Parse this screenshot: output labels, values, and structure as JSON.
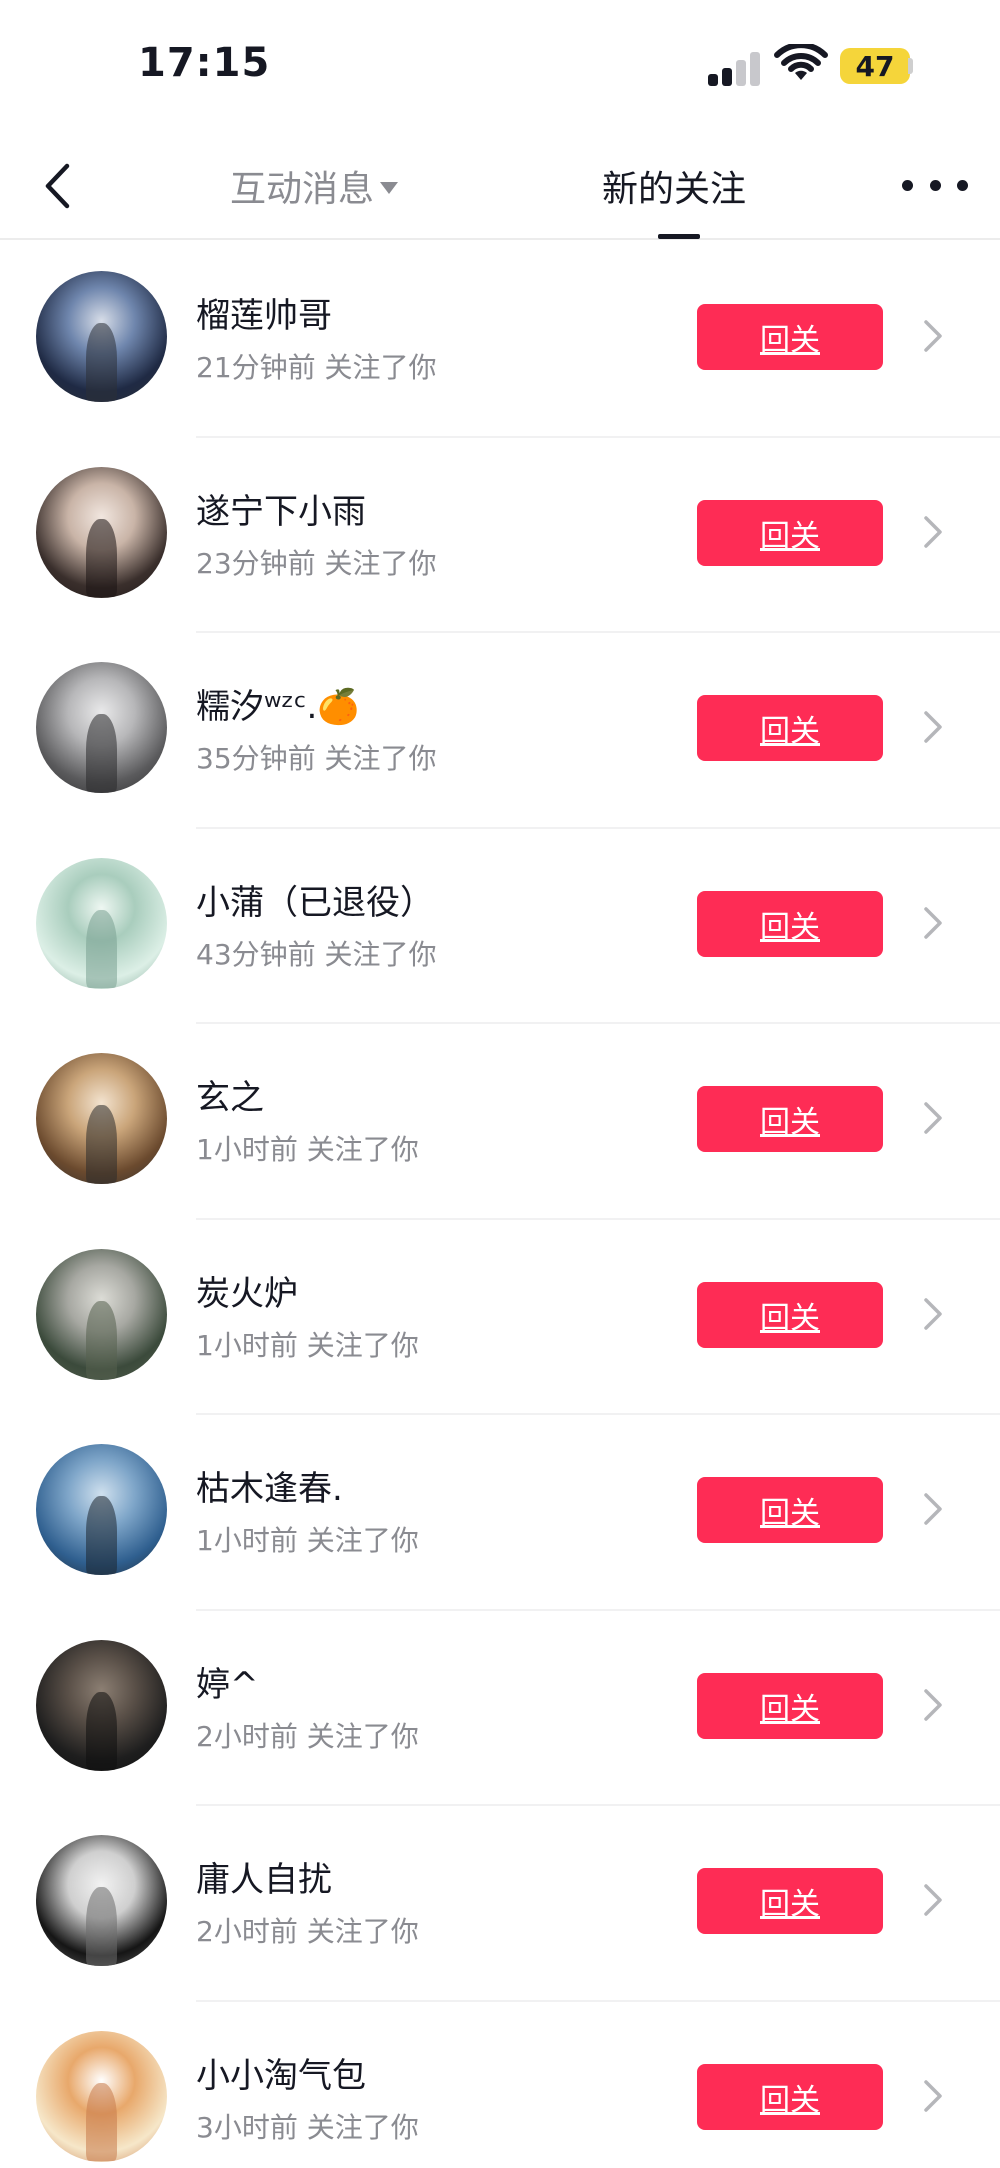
{
  "status_bar": {
    "time": "17:15",
    "battery": "47",
    "icons": [
      "cellular-signal-icon",
      "wifi-icon",
      "battery-icon"
    ],
    "battery_color": "#f5d53a"
  },
  "nav": {
    "back_icon": "back-arrow-icon",
    "tabs": [
      {
        "label": "互动消息",
        "active": false,
        "has_dropdown": true
      },
      {
        "label": "新的关注",
        "active": true
      }
    ],
    "more_icon": "more-dots-icon"
  },
  "accent_color": "#fe2c55",
  "followers": [
    {
      "name": "榴莲帅哥",
      "meta": "21分钟前 关注了你",
      "button": "回关",
      "avatar": {
        "palette": [
          "#1f2a44",
          "#6f86ad",
          "#d7dde8",
          "#2b2f36"
        ]
      }
    },
    {
      "name": "遂宁下小雨",
      "meta": "23分钟前 关注了你",
      "button": "回关",
      "avatar": {
        "palette": [
          "#3a2f2c",
          "#c9b4a7",
          "#f1e6df",
          "#1b1414"
        ]
      }
    },
    {
      "name": "糯汐ʷᶻᶜ.🍊",
      "meta": "35分钟前 关注了你",
      "button": "回关",
      "avatar": {
        "palette": [
          "#5a5a5c",
          "#b7b7b9",
          "#e9e9ea",
          "#2a2a2c"
        ]
      }
    },
    {
      "name": "小蒲（已退役）",
      "meta": "43分钟前 关注了你",
      "button": "回关",
      "avatar": {
        "palette": [
          "#dcefe6",
          "#a9cdbd",
          "#eef7f2",
          "#7aa191"
        ]
      }
    },
    {
      "name": "玄之",
      "meta": "1小时前 关注了你",
      "button": "回关",
      "avatar": {
        "palette": [
          "#6b4a2e",
          "#caa57a",
          "#f3e3cf",
          "#2b2b2b"
        ]
      }
    },
    {
      "name": "炭火炉",
      "meta": "1小时前 关注了你",
      "button": "回关",
      "avatar": {
        "palette": [
          "#3b4a3b",
          "#a7a8a2",
          "#dcdcd6",
          "#56604f"
        ]
      }
    },
    {
      "name": "枯木逢春.",
      "meta": "1小时前 关注了你",
      "button": "回关",
      "avatar": {
        "palette": [
          "#2f5f8f",
          "#7fa6c9",
          "#cfe0ee",
          "#1d2630"
        ]
      }
    },
    {
      "name": "婷^",
      "meta": "2小时前 关注了你",
      "button": "回关",
      "avatar": {
        "palette": [
          "#1e1e1e",
          "#5a5048",
          "#8c7f73",
          "#0e0e0e"
        ]
      }
    },
    {
      "name": "庸人自扰",
      "meta": "2小时前 关注了你",
      "button": "回关",
      "avatar": {
        "palette": [
          "#151515",
          "#cfcfcf",
          "#f2f2f2",
          "#6b6b6b"
        ]
      }
    },
    {
      "name": "小小淘气包",
      "meta": "3小时前 关注了你",
      "button": "回关",
      "avatar": {
        "palette": [
          "#f6e7c9",
          "#e8a86b",
          "#ffffff",
          "#c77a4a"
        ]
      }
    }
  ]
}
